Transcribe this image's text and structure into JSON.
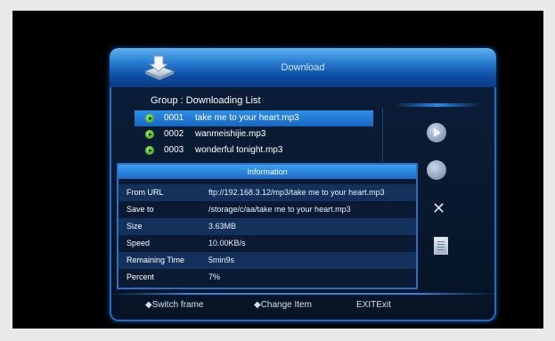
{
  "window": {
    "title": "Download"
  },
  "group_label": "Group : Downloading List",
  "downloads": [
    {
      "num": "0001",
      "name": "take me to your heart.mp3",
      "selected": true
    },
    {
      "num": "0002",
      "name": "wanmeishijie.mp3",
      "selected": false
    },
    {
      "num": "0003",
      "name": "wonderful tonight.mp3",
      "selected": false
    }
  ],
  "info": {
    "title": "Information",
    "rows": [
      {
        "key": "From URL",
        "value": "ftp://192.168.3.12/mp3/take me to your heart.mp3"
      },
      {
        "key": "Save to",
        "value": "/storage/c/aa/take me to your heart.mp3"
      },
      {
        "key": "Size",
        "value": "3.63MB"
      },
      {
        "key": "Speed",
        "value": "10.00KB/s"
      },
      {
        "key": "Remaining Time",
        "value": "5min9s"
      },
      {
        "key": "Percent",
        "value": "7%"
      }
    ]
  },
  "footer": {
    "switch_frame": "◆Switch frame",
    "change_item": "◆Change Item",
    "exit": "EXITExit"
  },
  "icons": {
    "app": "download-app-icon",
    "play": "play-icon",
    "stop": "stop-icon",
    "delete": "delete-icon",
    "info": "document-icon"
  },
  "colors": {
    "accent": "#2f8fe8",
    "bullet": "#4fcf2a"
  }
}
